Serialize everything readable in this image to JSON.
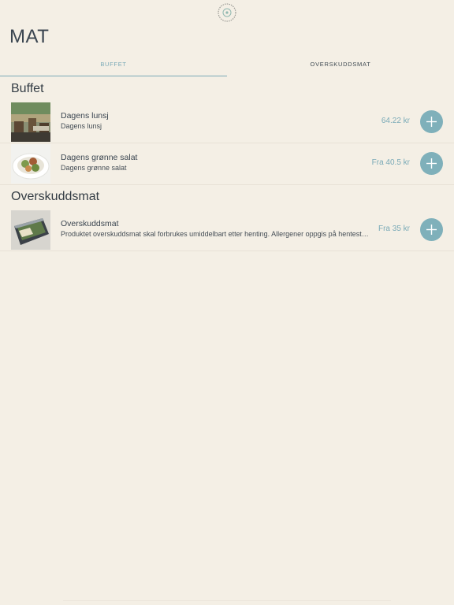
{
  "header": {
    "title": "MAT",
    "logo_icon": "circular-floral-logo"
  },
  "tabs": [
    {
      "label": "BUFFET",
      "active": true
    },
    {
      "label": "OVERSKUDDSMAT",
      "active": false
    }
  ],
  "sections": [
    {
      "title": "Buffet",
      "items": [
        {
          "name": "Dagens lunsj",
          "description": "Dagens lunsj",
          "price": "64.22 kr",
          "image": "restaurant-interior"
        },
        {
          "name": "Dagens grønne salat",
          "description": "Dagens grønne salat",
          "price": "Fra 40.5 kr",
          "image": "salad-bowl"
        }
      ]
    },
    {
      "title": "Overskuddsmat",
      "items": [
        {
          "name": "Overskuddsmat",
          "description": "Produktet overskuddsmat skal forbrukes umiddelbart etter henting. Allergener oppgis på hentested.",
          "price": "Fra 35 kr",
          "image": "food-box"
        }
      ]
    }
  ],
  "colors": {
    "accent": "#7fb0ba",
    "background": "#f4efe5",
    "text": "#333c44"
  }
}
